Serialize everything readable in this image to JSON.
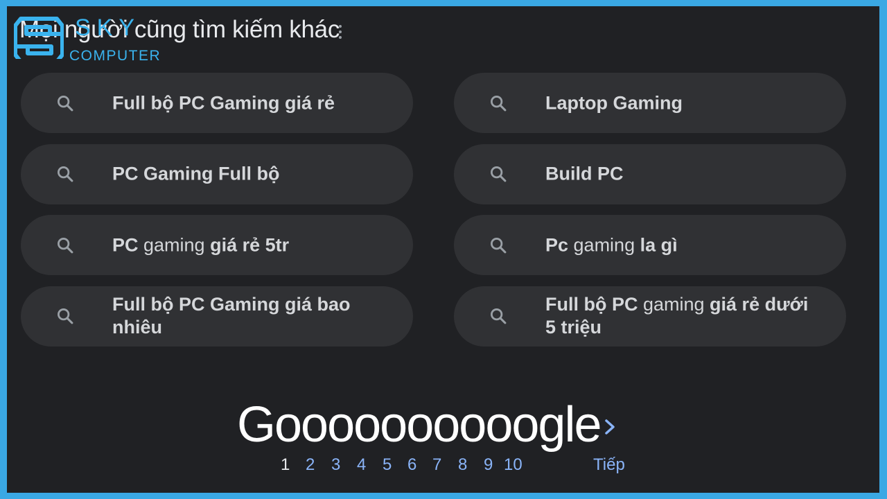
{
  "heading": "Mọi người cũng tìm kiếm khác",
  "watermark": {
    "brand": "SKY",
    "sub": "COMPUTER",
    "color": "#3ab3ee"
  },
  "suggestions": [
    {
      "parts": [
        [
          "Full bộ PC Gaming giá rẻ",
          true
        ]
      ]
    },
    {
      "parts": [
        [
          "Laptop Gaming",
          true
        ]
      ]
    },
    {
      "parts": [
        [
          "PC Gaming Full bộ",
          true
        ]
      ]
    },
    {
      "parts": [
        [
          "Build PC",
          true
        ]
      ]
    },
    {
      "parts": [
        [
          "PC",
          true
        ],
        [
          " gaming ",
          false
        ],
        [
          "giá rẻ 5tr",
          true
        ]
      ]
    },
    {
      "parts": [
        [
          "Pc",
          true
        ],
        [
          " gaming ",
          false
        ],
        [
          "la gì",
          true
        ]
      ]
    },
    {
      "parts": [
        [
          "Full bộ PC Gaming giá bao nhiêu",
          true
        ]
      ]
    },
    {
      "parts": [
        [
          "Full bộ PC",
          true
        ],
        [
          " gaming ",
          false
        ],
        [
          "giá rẻ dưới 5 triệu",
          true
        ]
      ]
    }
  ],
  "pagination": {
    "logo": "Goooooooooogle",
    "pages": [
      "1",
      "2",
      "3",
      "4",
      "5",
      "6",
      "7",
      "8",
      "9",
      "10"
    ],
    "current": "1",
    "next_label": "Tiếp"
  },
  "icons": {
    "search": "search-icon",
    "more": "more-vert-icon",
    "next": "chevron-right-icon"
  },
  "colors": {
    "background": "#202124",
    "chip": "#303134",
    "link": "#8ab4f8",
    "frame": "#3aa8e4"
  }
}
